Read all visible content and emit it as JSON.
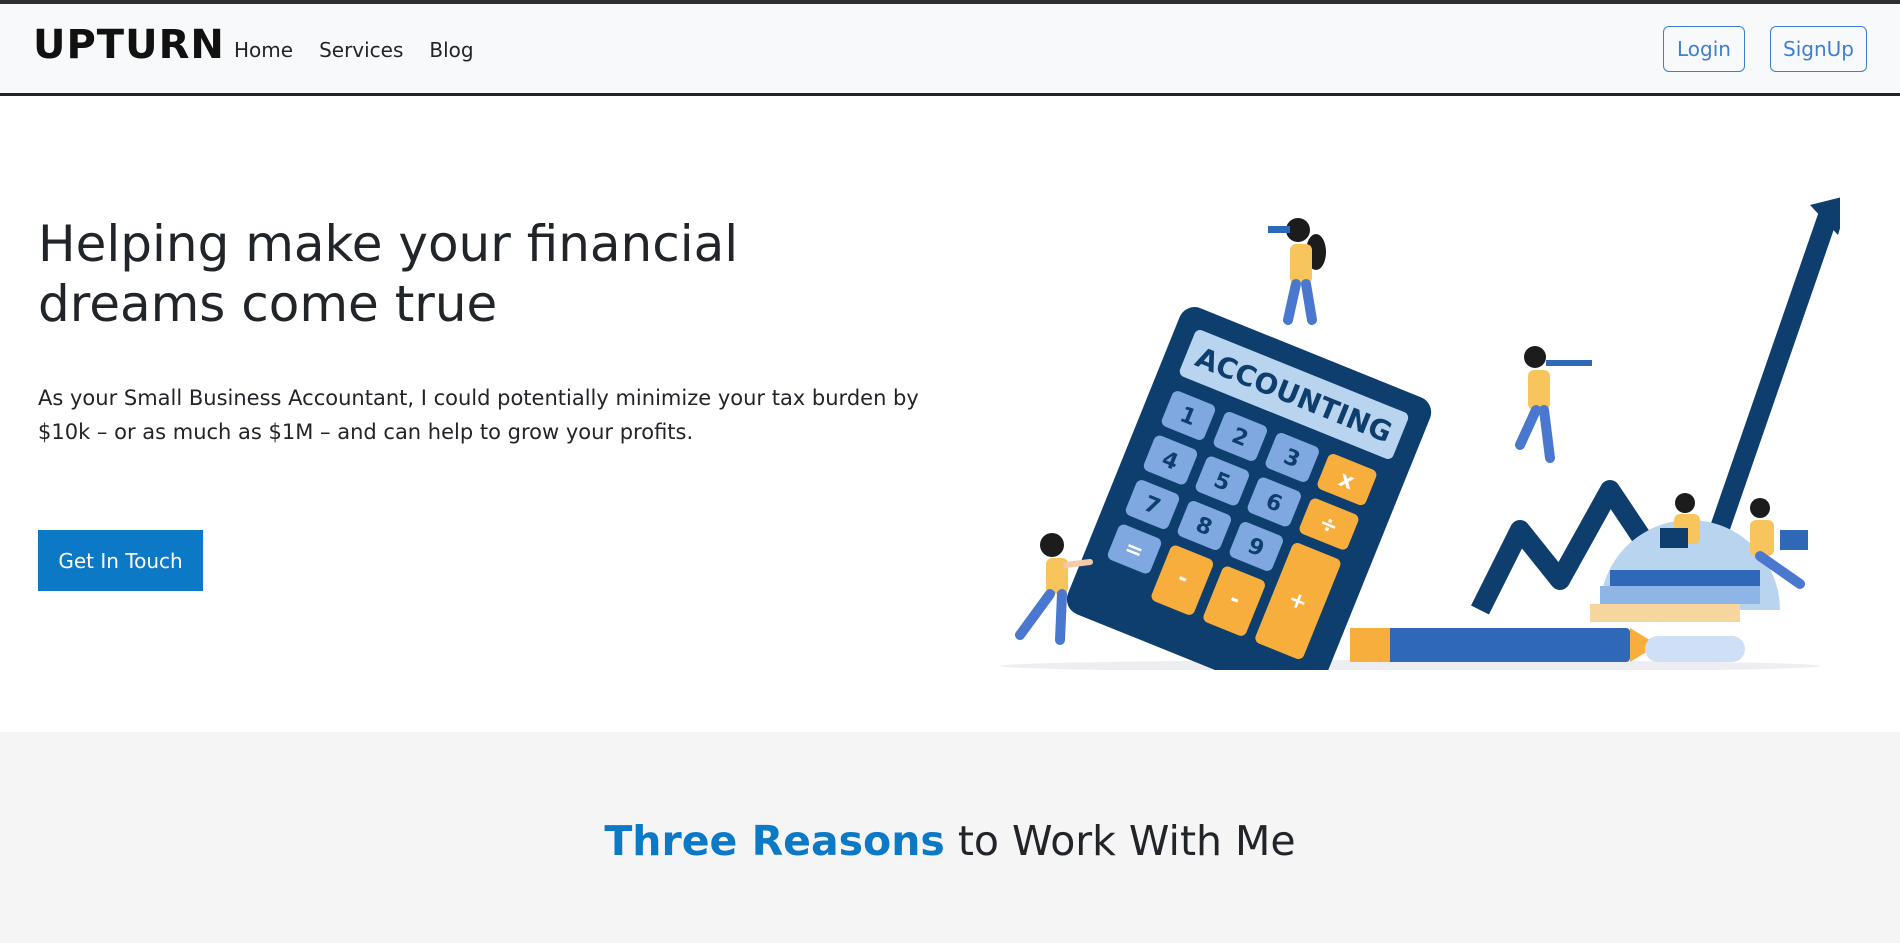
{
  "navbar": {
    "brand": "UPTURN",
    "links": [
      "Home",
      "Services",
      "Blog"
    ],
    "login_label": "Login",
    "signup_label": "SignUp"
  },
  "hero": {
    "title": "Helping make your financial dreams come true",
    "text": "As your Small Business Accountant, I could potentially minimize your tax burden by $10k – or as much as $1M – and can help to grow your profits.",
    "cta_label": "Get In Touch",
    "illustration": {
      "calculator_label": "ACCOUNTING",
      "keys": [
        "1",
        "2",
        "3",
        "4",
        "5",
        "6",
        "7",
        "8",
        "9",
        "x",
        "÷",
        "=",
        "-",
        "-",
        "+"
      ]
    }
  },
  "reasons": {
    "title_highlight": "Three Reasons",
    "title_rest": " to Work With Me"
  },
  "colors": {
    "accent": "#0b79c5",
    "outline_button": "#3f7fd0",
    "navbar_bg": "#f8f9fa",
    "section_bg": "#f5f5f6",
    "illustration_navy": "#0e3e6e",
    "illustration_orange": "#f8ae3c"
  }
}
